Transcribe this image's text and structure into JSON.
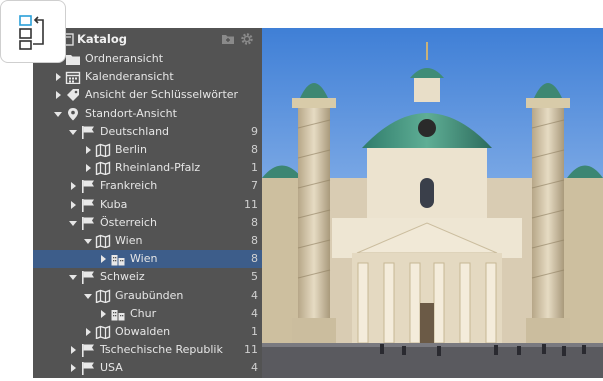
{
  "panel": {
    "title": "Katalog"
  },
  "tree": [
    {
      "label": "Ordneransicht",
      "count": "",
      "depth": 0,
      "expander": "none",
      "icon": "folder-icon"
    },
    {
      "label": "Kalenderansicht",
      "count": "",
      "depth": 0,
      "expander": "collapsed",
      "icon": "calendar-icon"
    },
    {
      "label": "Ansicht der Schlüsselwörter",
      "count": "",
      "depth": 0,
      "expander": "collapsed",
      "icon": "tag-icon"
    },
    {
      "label": "Standort-Ansicht",
      "count": "",
      "depth": 0,
      "expander": "expanded",
      "icon": "pin-icon"
    },
    {
      "label": "Deutschland",
      "count": "9",
      "depth": 1,
      "expander": "expanded",
      "icon": "flag-icon"
    },
    {
      "label": "Berlin",
      "count": "8",
      "depth": 2,
      "expander": "collapsed",
      "icon": "map-icon"
    },
    {
      "label": "Rheinland-Pfalz",
      "count": "1",
      "depth": 2,
      "expander": "collapsed",
      "icon": "map-icon"
    },
    {
      "label": "Frankreich",
      "count": "7",
      "depth": 1,
      "expander": "collapsed",
      "icon": "flag-icon"
    },
    {
      "label": "Kuba",
      "count": "11",
      "depth": 1,
      "expander": "collapsed",
      "icon": "flag-icon"
    },
    {
      "label": "Österreich",
      "count": "8",
      "depth": 1,
      "expander": "expanded",
      "icon": "flag-icon"
    },
    {
      "label": "Wien",
      "count": "8",
      "depth": 2,
      "expander": "expanded",
      "icon": "map-icon"
    },
    {
      "label": "Wien",
      "count": "8",
      "depth": 3,
      "expander": "collapsed",
      "icon": "city-icon",
      "selected": true
    },
    {
      "label": "Schweiz",
      "count": "5",
      "depth": 1,
      "expander": "expanded",
      "icon": "flag-icon"
    },
    {
      "label": "Graubünden",
      "count": "4",
      "depth": 2,
      "expander": "expanded",
      "icon": "map-icon"
    },
    {
      "label": "Chur",
      "count": "4",
      "depth": 3,
      "expander": "collapsed",
      "icon": "city-icon"
    },
    {
      "label": "Obwalden",
      "count": "1",
      "depth": 2,
      "expander": "collapsed",
      "icon": "map-icon"
    },
    {
      "label": "Tschechische Republik",
      "count": "11",
      "depth": 1,
      "expander": "collapsed",
      "icon": "flag-icon"
    },
    {
      "label": "USA",
      "count": "4",
      "depth": 1,
      "expander": "collapsed",
      "icon": "flag-icon"
    }
  ],
  "colors": {
    "panel_bg": "#535353",
    "selection": "#3d5d8a",
    "text": "#e6e6e6"
  }
}
